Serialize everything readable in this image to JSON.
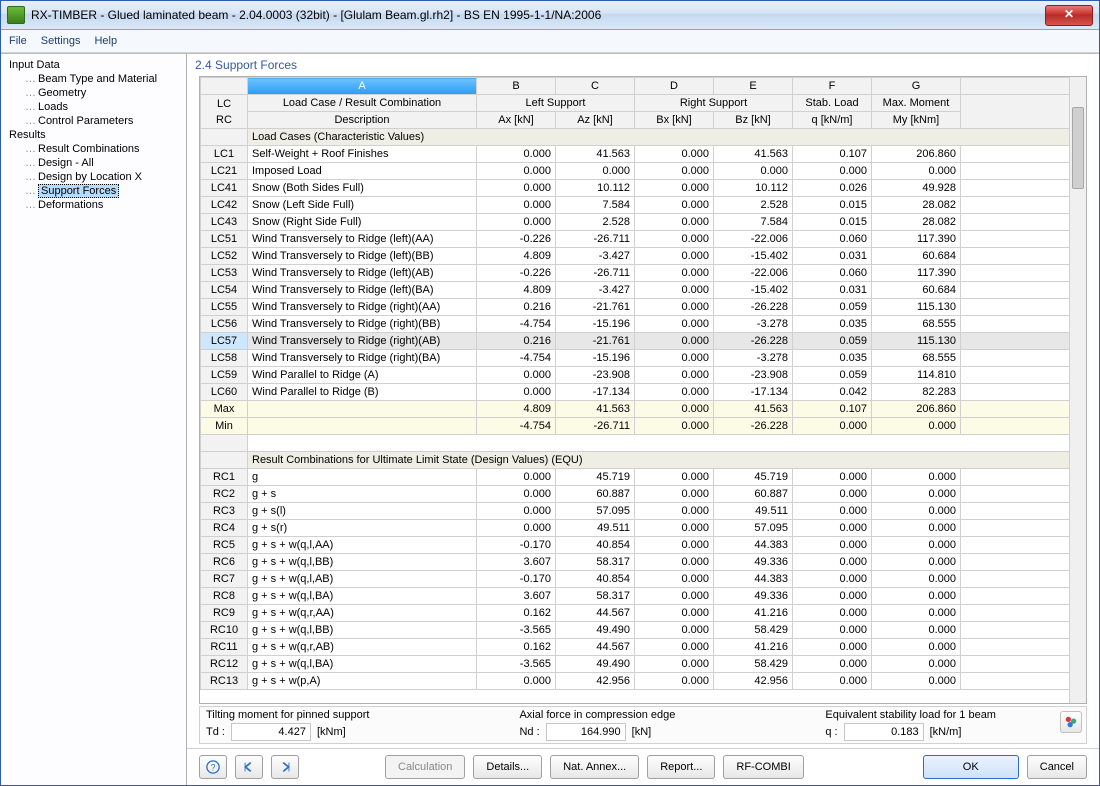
{
  "window": {
    "title": "RX-TIMBER - Glued laminated beam - 2.04.0003 (32bit) - [Glulam Beam.gl.rh2] - BS EN 1995-1-1/NA:2006"
  },
  "menubar": [
    "File",
    "Settings",
    "Help"
  ],
  "sidebar": {
    "groups": [
      {
        "label": "Input Data",
        "children": [
          "Beam Type and Material",
          "Geometry",
          "Loads",
          "Control Parameters"
        ]
      },
      {
        "label": "Results",
        "children": [
          "Result Combinations",
          "Design - All",
          "Design by Location X",
          "Support Forces",
          "Deformations"
        ],
        "selectedIndex": 3
      }
    ]
  },
  "panel": {
    "title": "2.4 Support Forces",
    "colLetters": [
      "A",
      "B",
      "C",
      "D",
      "E",
      "F",
      "G"
    ],
    "header1": {
      "rc": "LC\nRC",
      "a": "Load Case / Result Combination",
      "bc": "Left Support",
      "de": "Right Support",
      "f": "Stab. Load",
      "g": "Max. Moment"
    },
    "header2": {
      "a": "Description",
      "b": "Ax [kN]",
      "c": "Az [kN]",
      "d": "Bx [kN]",
      "e": "Bz [kN]",
      "f": "q [kN/m]",
      "g": "My [kNm]"
    },
    "section1": "Load Cases (Characteristic Values)",
    "lcRows": [
      {
        "id": "LC1",
        "desc": "Self-Weight + Roof Finishes",
        "v": [
          "0.000",
          "41.563",
          "0.000",
          "41.563",
          "0.107",
          "206.860"
        ]
      },
      {
        "id": "LC21",
        "desc": "Imposed Load",
        "v": [
          "0.000",
          "0.000",
          "0.000",
          "0.000",
          "0.000",
          "0.000"
        ]
      },
      {
        "id": "LC41",
        "desc": "Snow (Both Sides Full)",
        "v": [
          "0.000",
          "10.112",
          "0.000",
          "10.112",
          "0.026",
          "49.928"
        ]
      },
      {
        "id": "LC42",
        "desc": "Snow (Left Side Full)",
        "v": [
          "0.000",
          "7.584",
          "0.000",
          "2.528",
          "0.015",
          "28.082"
        ]
      },
      {
        "id": "LC43",
        "desc": "Snow (Right Side Full)",
        "v": [
          "0.000",
          "2.528",
          "0.000",
          "7.584",
          "0.015",
          "28.082"
        ]
      },
      {
        "id": "LC51",
        "desc": "Wind Transversely to Ridge (left)(AA)",
        "v": [
          "-0.226",
          "-26.711",
          "0.000",
          "-22.006",
          "0.060",
          "117.390"
        ]
      },
      {
        "id": "LC52",
        "desc": "Wind Transversely to Ridge (left)(BB)",
        "v": [
          "4.809",
          "-3.427",
          "0.000",
          "-15.402",
          "0.031",
          "60.684"
        ]
      },
      {
        "id": "LC53",
        "desc": "Wind Transversely to Ridge (left)(AB)",
        "v": [
          "-0.226",
          "-26.711",
          "0.000",
          "-22.006",
          "0.060",
          "117.390"
        ]
      },
      {
        "id": "LC54",
        "desc": "Wind Transversely to Ridge (left)(BA)",
        "v": [
          "4.809",
          "-3.427",
          "0.000",
          "-15.402",
          "0.031",
          "60.684"
        ]
      },
      {
        "id": "LC55",
        "desc": "Wind Transversely to Ridge (right)(AA)",
        "v": [
          "0.216",
          "-21.761",
          "0.000",
          "-26.228",
          "0.059",
          "115.130"
        ]
      },
      {
        "id": "LC56",
        "desc": "Wind Transversely to Ridge (right)(BB)",
        "v": [
          "-4.754",
          "-15.196",
          "0.000",
          "-3.278",
          "0.035",
          "68.555"
        ]
      },
      {
        "id": "LC57",
        "desc": "Wind Transversely to Ridge (right)(AB)",
        "v": [
          "0.216",
          "-21.761",
          "0.000",
          "-26.228",
          "0.059",
          "115.130"
        ],
        "selected": true
      },
      {
        "id": "LC58",
        "desc": "Wind Transversely to Ridge (right)(BA)",
        "v": [
          "-4.754",
          "-15.196",
          "0.000",
          "-3.278",
          "0.035",
          "68.555"
        ]
      },
      {
        "id": "LC59",
        "desc": "Wind Parallel to Ridge (A)",
        "v": [
          "0.000",
          "-23.908",
          "0.000",
          "-23.908",
          "0.059",
          "114.810"
        ]
      },
      {
        "id": "LC60",
        "desc": "Wind Parallel to Ridge (B)",
        "v": [
          "0.000",
          "-17.134",
          "0.000",
          "-17.134",
          "0.042",
          "82.283"
        ]
      }
    ],
    "maxRow": {
      "id": "Max",
      "v": [
        "4.809",
        "41.563",
        "0.000",
        "41.563",
        "0.107",
        "206.860"
      ]
    },
    "minRow": {
      "id": "Min",
      "v": [
        "-4.754",
        "-26.711",
        "0.000",
        "-26.228",
        "0.000",
        "0.000"
      ]
    },
    "section2": "Result Combinations for Ultimate Limit State (Design Values) (EQU)",
    "rcRows": [
      {
        "id": "RC1",
        "desc": "g",
        "v": [
          "0.000",
          "45.719",
          "0.000",
          "45.719",
          "0.000",
          "0.000"
        ]
      },
      {
        "id": "RC2",
        "desc": "g + s",
        "v": [
          "0.000",
          "60.887",
          "0.000",
          "60.887",
          "0.000",
          "0.000"
        ]
      },
      {
        "id": "RC3",
        "desc": "g + s(l)",
        "v": [
          "0.000",
          "57.095",
          "0.000",
          "49.511",
          "0.000",
          "0.000"
        ]
      },
      {
        "id": "RC4",
        "desc": "g + s(r)",
        "v": [
          "0.000",
          "49.511",
          "0.000",
          "57.095",
          "0.000",
          "0.000"
        ]
      },
      {
        "id": "RC5",
        "desc": "g + s + w(q,l,AA)",
        "v": [
          "-0.170",
          "40.854",
          "0.000",
          "44.383",
          "0.000",
          "0.000"
        ]
      },
      {
        "id": "RC6",
        "desc": "g + s + w(q,l,BB)",
        "v": [
          "3.607",
          "58.317",
          "0.000",
          "49.336",
          "0.000",
          "0.000"
        ]
      },
      {
        "id": "RC7",
        "desc": "g + s + w(q,l,AB)",
        "v": [
          "-0.170",
          "40.854",
          "0.000",
          "44.383",
          "0.000",
          "0.000"
        ]
      },
      {
        "id": "RC8",
        "desc": "g + s + w(q,l,BA)",
        "v": [
          "3.607",
          "58.317",
          "0.000",
          "49.336",
          "0.000",
          "0.000"
        ]
      },
      {
        "id": "RC9",
        "desc": "g + s + w(q,r,AA)",
        "v": [
          "0.162",
          "44.567",
          "0.000",
          "41.216",
          "0.000",
          "0.000"
        ]
      },
      {
        "id": "RC10",
        "desc": "g + s + w(q,l,BB)",
        "v": [
          "-3.565",
          "49.490",
          "0.000",
          "58.429",
          "0.000",
          "0.000"
        ]
      },
      {
        "id": "RC11",
        "desc": "g + s + w(q,r,AB)",
        "v": [
          "0.162",
          "44.567",
          "0.000",
          "41.216",
          "0.000",
          "0.000"
        ]
      },
      {
        "id": "RC12",
        "desc": "g + s + w(q,l,BA)",
        "v": [
          "-3.565",
          "49.490",
          "0.000",
          "58.429",
          "0.000",
          "0.000"
        ]
      },
      {
        "id": "RC13",
        "desc": "g + s + w(p,A)",
        "v": [
          "0.000",
          "42.956",
          "0.000",
          "42.956",
          "0.000",
          "0.000"
        ]
      }
    ]
  },
  "summary": {
    "col1": {
      "title": "Tilting moment for pinned support",
      "sym": "Td :",
      "val": "4.427",
      "unit": "[kNm]"
    },
    "col2": {
      "title": "Axial force in compression edge",
      "sym": "Nd :",
      "val": "164.990",
      "unit": "[kN]"
    },
    "col3": {
      "title": "Equivalent stability load for 1 beam",
      "sym": "q :",
      "val": "0.183",
      "unit": "[kN/m]"
    }
  },
  "footer": {
    "help": "?",
    "calculation": "Calculation",
    "details": "Details...",
    "natAnnex": "Nat. Annex...",
    "report": "Report...",
    "rfcombi": "RF-COMBI",
    "ok": "OK",
    "cancel": "Cancel"
  }
}
